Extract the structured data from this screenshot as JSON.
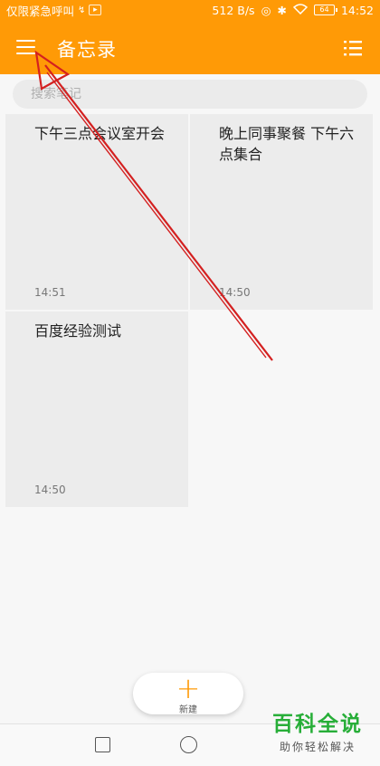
{
  "status_bar": {
    "left_text": "仅限紧急呼叫",
    "speed": "512 B/s",
    "battery": "64",
    "time": "14:52"
  },
  "app_bar": {
    "title": "备忘录",
    "menu_icon": "hamburger-menu-icon",
    "list_icon": "list-view-icon",
    "color": "#ff9a06"
  },
  "search": {
    "placeholder": "搜索笔记"
  },
  "notes": [
    {
      "title": "下午三点会议室开会",
      "time": "14:51"
    },
    {
      "title": "晚上同事聚餐 下午六点集合",
      "time": "14:50"
    },
    {
      "title": "百度经验测试",
      "time": "14:50"
    }
  ],
  "fab": {
    "icon": "plus-icon",
    "label": "新建"
  },
  "nav": {
    "recent_icon": "square-recent-apps-icon",
    "home_icon": "circle-home-icon"
  },
  "watermark": {
    "title": "百科全说",
    "subtitle": "助你轻松解决"
  },
  "annotation": {
    "arrow_color": "#d42020"
  }
}
